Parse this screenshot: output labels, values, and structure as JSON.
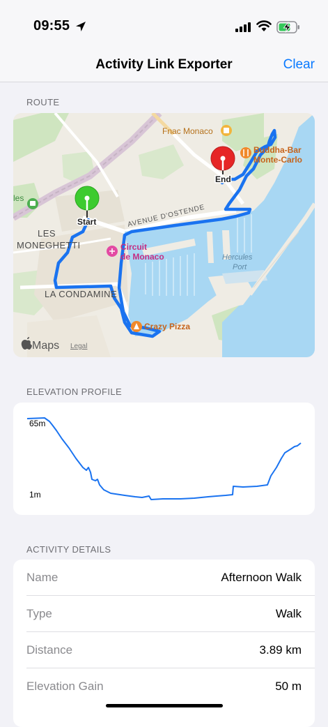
{
  "status_bar": {
    "time": "09:55"
  },
  "nav": {
    "title": "Activity Link Exporter",
    "clear_label": "Clear"
  },
  "sections": {
    "route": "ROUTE",
    "elevation": "ELEVATION PROFILE",
    "details": "ACTIVITY DETAILS"
  },
  "map": {
    "labels": {
      "fnac": "Fnac Monaco",
      "buddha_1": "Buddha-Bar",
      "buddha_2": "Monte-Carlo",
      "end": "End",
      "start": "Start",
      "avenue": "AVENUE D'OSTENDE",
      "les": "LES",
      "moneghetti": "MONEGHETTI",
      "circuit_1": "Circuit",
      "circuit_2": "de Monaco",
      "hercules_1": "Hercules",
      "hercules_2": "Port",
      "condamine": "LA CONDAMINE",
      "crazy_pizza": "Crazy Pizza",
      "edge_left": "les",
      "maps": "Maps",
      "legal": "Legal"
    },
    "colors": {
      "route": "#1a73f0",
      "water": "#a8d7f3",
      "land": "#efece4"
    }
  },
  "elevation": {
    "max_label": "65m",
    "min_label": "1m",
    "line_color": "#1a73f0"
  },
  "details": [
    {
      "label": "Name",
      "value": "Afternoon Walk"
    },
    {
      "label": "Type",
      "value": "Walk"
    },
    {
      "label": "Distance",
      "value": "3.89 km"
    },
    {
      "label": "Elevation Gain",
      "value": "50 m"
    }
  ]
}
